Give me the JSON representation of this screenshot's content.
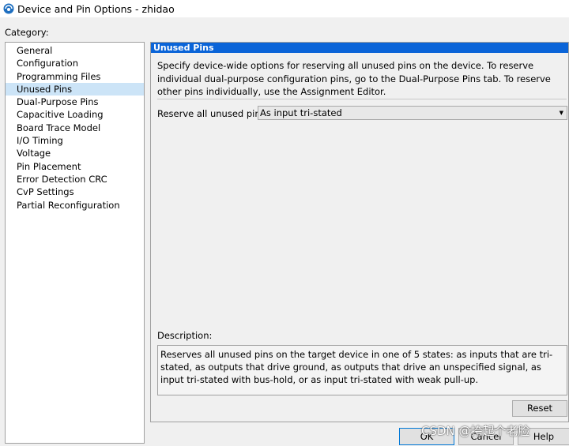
{
  "window": {
    "title": "Device and Pin Options - zhidao"
  },
  "category": {
    "label": "Category:",
    "items": [
      "General",
      "Configuration",
      "Programming Files",
      "Unused Pins",
      "Dual-Purpose Pins",
      "Capacitive Loading",
      "Board Trace Model",
      "I/O Timing",
      "Voltage",
      "Pin Placement",
      "Error Detection CRC",
      "CvP Settings",
      "Partial Reconfiguration"
    ],
    "selected_index": 3
  },
  "panel": {
    "header": "Unused Pins",
    "intro": "Specify device-wide options for reserving all unused pins on the device. To reserve individual dual-purpose configuration pins, go to the Dual-Purpose Pins tab. To reserve other pins individually, use the Assignment Editor.",
    "reserve_label": "Reserve all unused pins:",
    "reserve_value": "As input tri-stated",
    "description_label": "Description:",
    "description": "Reserves all unused pins on the target device in one of 5 states: as inputs that are tri-stated, as outputs that drive ground, as outputs that drive an unspecified signal, as input tri-stated with bus-hold, or as input tri-stated with weak pull-up.",
    "reset_label": "Reset"
  },
  "footer": {
    "ok_label": "OK",
    "cancel_label": "Cancel",
    "help_label": "Help"
  },
  "watermark": "CSDN @挎起个老脸",
  "colors": {
    "header_bg": "#0a64d8",
    "selected_bg": "#cce4f7"
  }
}
